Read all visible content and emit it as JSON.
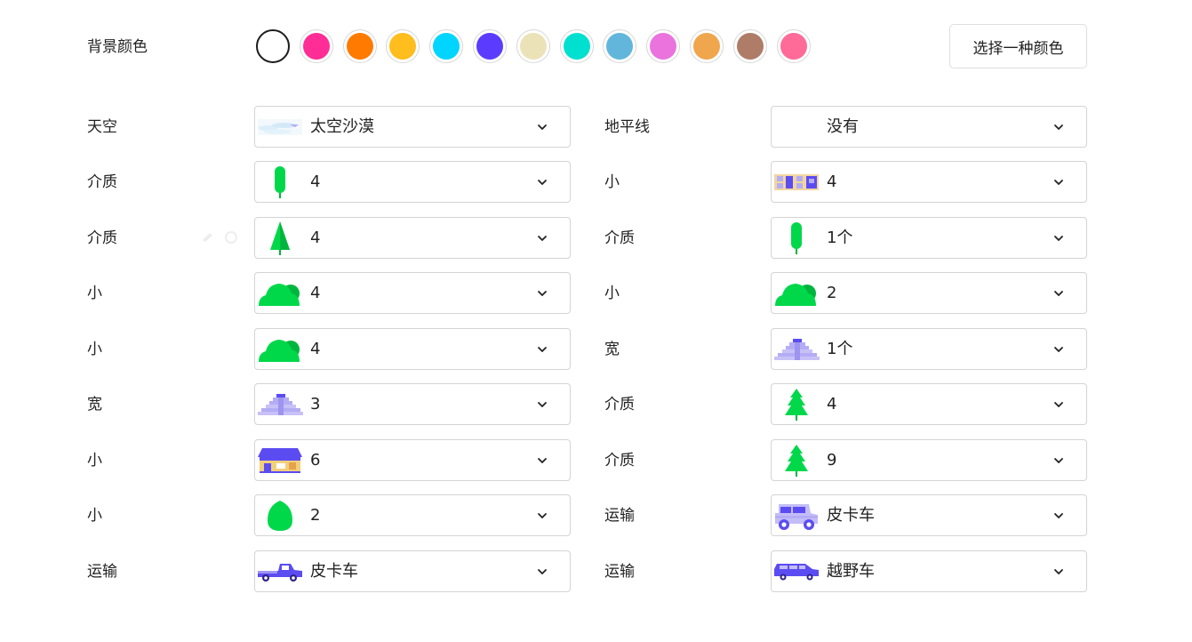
{
  "background": {
    "label": "背景颜色",
    "swatches": [
      "#ffffff",
      "#ff2d95",
      "#ff7a00",
      "#ffbd1e",
      "#00d5ff",
      "#5b3cff",
      "#ece2b8",
      "#00e0d0",
      "#62b6dc",
      "#ea73de",
      "#f0a64d",
      "#ae7c67",
      "#ff6b98"
    ],
    "selected_index": 0,
    "pick_button": "选择一种颜色"
  },
  "left_rows": [
    {
      "label": "天空",
      "value": "太空沙漠",
      "icon": "sky-clouds-icon"
    },
    {
      "label": "介质",
      "value": "4",
      "icon": "poplar-tree-icon"
    },
    {
      "label": "介质",
      "value": "4",
      "icon": "pine-tree-icon"
    },
    {
      "label": "小",
      "value": "4",
      "icon": "bush-icon"
    },
    {
      "label": "小",
      "value": "4",
      "icon": "bush-icon"
    },
    {
      "label": "宽",
      "value": "3",
      "icon": "pyramid-icon"
    },
    {
      "label": "小",
      "value": "6",
      "icon": "house-icon"
    },
    {
      "label": "小",
      "value": "2",
      "icon": "oval-tree-icon"
    },
    {
      "label": "运输",
      "value": "皮卡车",
      "icon": "pickup-truck-icon"
    }
  ],
  "right_rows": [
    {
      "label": "地平线",
      "value": "没有",
      "icon": "none"
    },
    {
      "label": "小",
      "value": "4",
      "icon": "building-icon"
    },
    {
      "label": "介质",
      "value": "1个",
      "icon": "poplar-tree-icon"
    },
    {
      "label": "小",
      "value": "2",
      "icon": "bush-icon"
    },
    {
      "label": "宽",
      "value": "1个",
      "icon": "pyramid-icon"
    },
    {
      "label": "介质",
      "value": "4",
      "icon": "fir-tree-icon"
    },
    {
      "label": "介质",
      "value": "9",
      "icon": "fir-tree-icon"
    },
    {
      "label": "运输",
      "value": "皮卡车",
      "icon": "jeep-icon"
    },
    {
      "label": "运输",
      "value": "越野车",
      "icon": "suv-icon"
    }
  ],
  "colors": {
    "green": "#00d84a",
    "green_dark": "#00b53e",
    "purple": "#5b4cf2",
    "lavender": "#b4adf5"
  }
}
